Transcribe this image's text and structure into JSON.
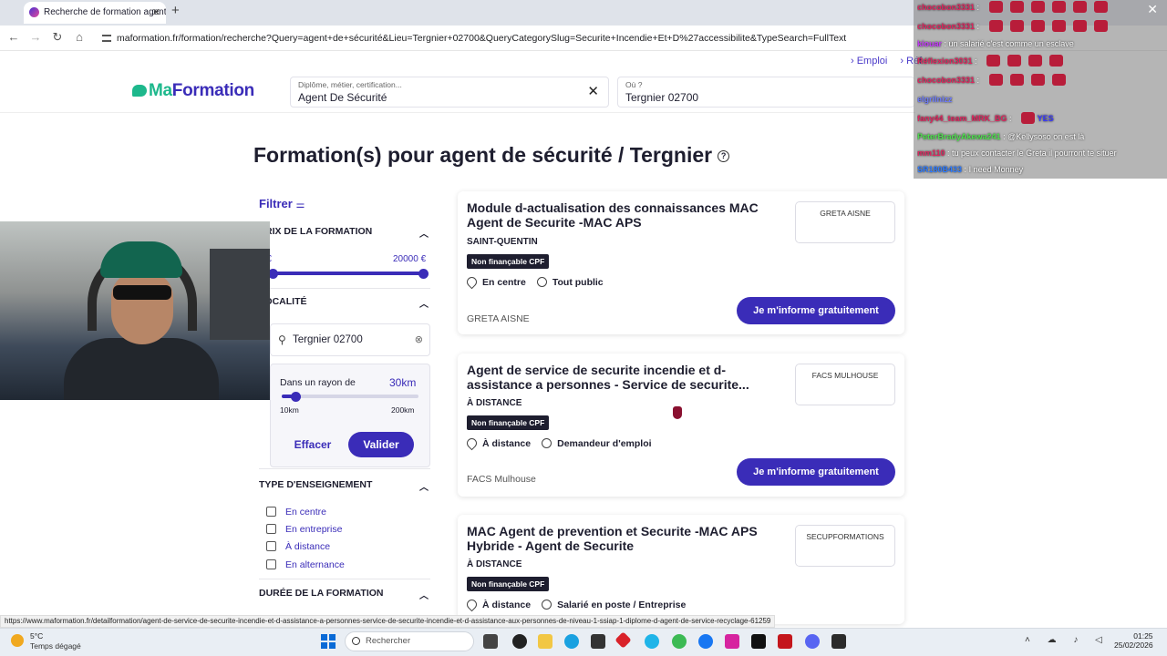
{
  "browser": {
    "tab_title": "Recherche de formation agent",
    "url": "maformation.fr/formation/recherche?Query=agent+de+sécurité&Lieu=Tergnier+02700&QueryCategorySlug=Securite+Incendie+Et+D%27accessibilite&TypeSearch=FullText",
    "status_url": "https://www.maformation.fr/detailformation/agent-de-service-de-securite-incendie-et-d-assistance-a-personnes-service-de-securite-incendie-et-d-assistance-aux-personnes-de-niveau-1-ssiap-1-diplome-d-agent-de-service-recyclage-61259"
  },
  "site": {
    "logo_ma": "Ma",
    "logo_formation": "Formation",
    "top_links": [
      "› Emploi",
      "› Réf"
    ],
    "query_placeholder": "Diplôme, métier, certification...",
    "query_value": "Agent De Sécurité",
    "where_placeholder": "Où ?",
    "where_value": "Tergnier 02700"
  },
  "page": {
    "title": "Formation(s) pour agent de sécurité / Tergnier",
    "help_icon": "?"
  },
  "filters": {
    "title": "Filtrer",
    "price_section": "PRIX DE LA FORMATION",
    "price_min": "0 €",
    "price_max": "20000 €",
    "location_section": "LOCALITÉ",
    "location_value": "Tergnier 02700",
    "radius_label": "Dans un rayon de",
    "radius_value": "30km",
    "radius_min": "10km",
    "radius_max": "200km",
    "radius_fraction": 0.1,
    "clear_label": "Effacer",
    "apply_label": "Valider",
    "teaching_section": "TYPE D'ENSEIGNEMENT",
    "teaching_options": [
      "En centre",
      "En entreprise",
      "À distance",
      "En alternance"
    ],
    "duration_section": "DURÉE DE LA FORMATION"
  },
  "results": [
    {
      "title": "Module d-actualisation des connaissances MAC Agent de Securite -MAC APS",
      "location": "SAINT-QUENTIN",
      "badge": "Non finançable CPF",
      "mode": "En centre",
      "audience": "Tout public",
      "org": "GRETA AISNE",
      "org_box": "GRETA AISNE",
      "cta": "Je m'informe gratuitement"
    },
    {
      "title": "Agent de service de securite incendie et d-assistance a personnes - Service de securite...",
      "location": "À DISTANCE",
      "badge": "Non finançable CPF",
      "mode": "À distance",
      "audience": "Demandeur d'emploi",
      "org": "FACS Mulhouse",
      "org_box": "FACS MULHOUSE",
      "cta": "Je m'informe gratuitement"
    },
    {
      "title": "MAC Agent de prevention et Securite -MAC APS Hybride - Agent de Securite",
      "location": "À DISTANCE",
      "badge": "Non finançable CPF",
      "mode": "À distance",
      "audience": "Salarié en poste / Entreprise",
      "org": "",
      "org_box": "SECUPFORMATIONS",
      "cta": "Je m'informe gratuitement"
    }
  ],
  "chat": [
    {
      "user": "chocobon3331",
      "msg": ""
    },
    {
      "user": "chocobon3331",
      "msg": ""
    },
    {
      "user": "kiouar",
      "msg": "un salarié c'est comme un esclave"
    },
    {
      "user": "Réflexion3031",
      "msg": ""
    },
    {
      "user": "chocobon3331",
      "msg": ""
    },
    {
      "user": "elgrilnizz",
      "msg": ""
    },
    {
      "user": "fany44_team_MRK_BG",
      "msg": "YES"
    },
    {
      "user": "PeterBradyAkewa241",
      "msg": "@Kellysoso on est là"
    },
    {
      "user": "mm110",
      "msg": "tu peux contacter le Greta il pourront te situer"
    },
    {
      "user": "SR180B433",
      "msg": "I need Monney"
    }
  ],
  "taskbar": {
    "temp": "5°C",
    "weather": "Temps dégagé",
    "search_placeholder": "Rechercher",
    "time": "01:25",
    "date": "25/02/2026"
  },
  "colors": {
    "brand": "#3a2cb8",
    "accent_green": "#1db88c",
    "badge_bg": "#1e1e2f"
  }
}
